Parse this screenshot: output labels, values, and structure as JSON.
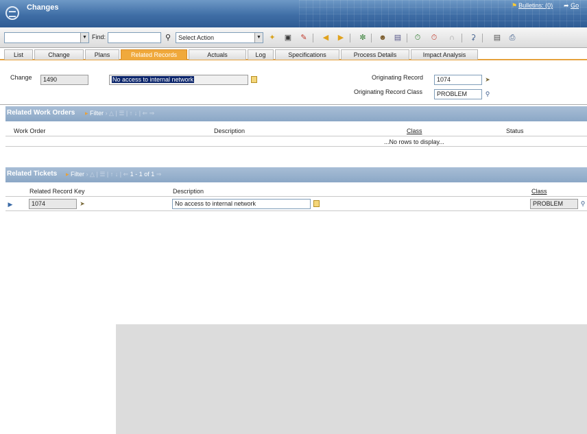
{
  "app": {
    "title": "Changes",
    "bulletins": "Bulletins: (0)",
    "go": "Go"
  },
  "toolbar": {
    "find_label": "Find:",
    "action_select": "Select Action",
    "query_select": "",
    "find_value": ""
  },
  "tabs": [
    {
      "label": "List"
    },
    {
      "label": "Change"
    },
    {
      "label": "Plans"
    },
    {
      "label": "Related Records"
    },
    {
      "label": "Actuals"
    },
    {
      "label": "Log"
    },
    {
      "label": "Specifications"
    },
    {
      "label": "Process Details"
    },
    {
      "label": "Impact Analysis"
    }
  ],
  "active_tab": "Related Records",
  "form": {
    "change_label": "Change",
    "change_value": "1490",
    "description_value": "No access to internal network",
    "originating_record_label": "Originating Record",
    "originating_record_value": "1074",
    "originating_class_label": "Originating Record Class",
    "originating_class_value": "PROBLEM"
  },
  "related_work_orders": {
    "title": "Related Work Orders",
    "filter_label": "Filter",
    "columns": [
      "Work Order",
      "Description",
      "Class",
      "Status"
    ],
    "empty_text": "...No rows to display..."
  },
  "related_tickets": {
    "title": "Related Tickets",
    "filter_label": "Filter",
    "pagination": "1 - 1 of 1",
    "columns": [
      "Related Record Key",
      "Description",
      "Class"
    ],
    "rows": [
      {
        "key": "1074",
        "description": "No access to internal network",
        "class": "PROBLEM"
      }
    ]
  },
  "colors": {
    "header": "#3f6ea6",
    "active_tab": "#f0a93c",
    "section_header": "#8ba7c6"
  }
}
